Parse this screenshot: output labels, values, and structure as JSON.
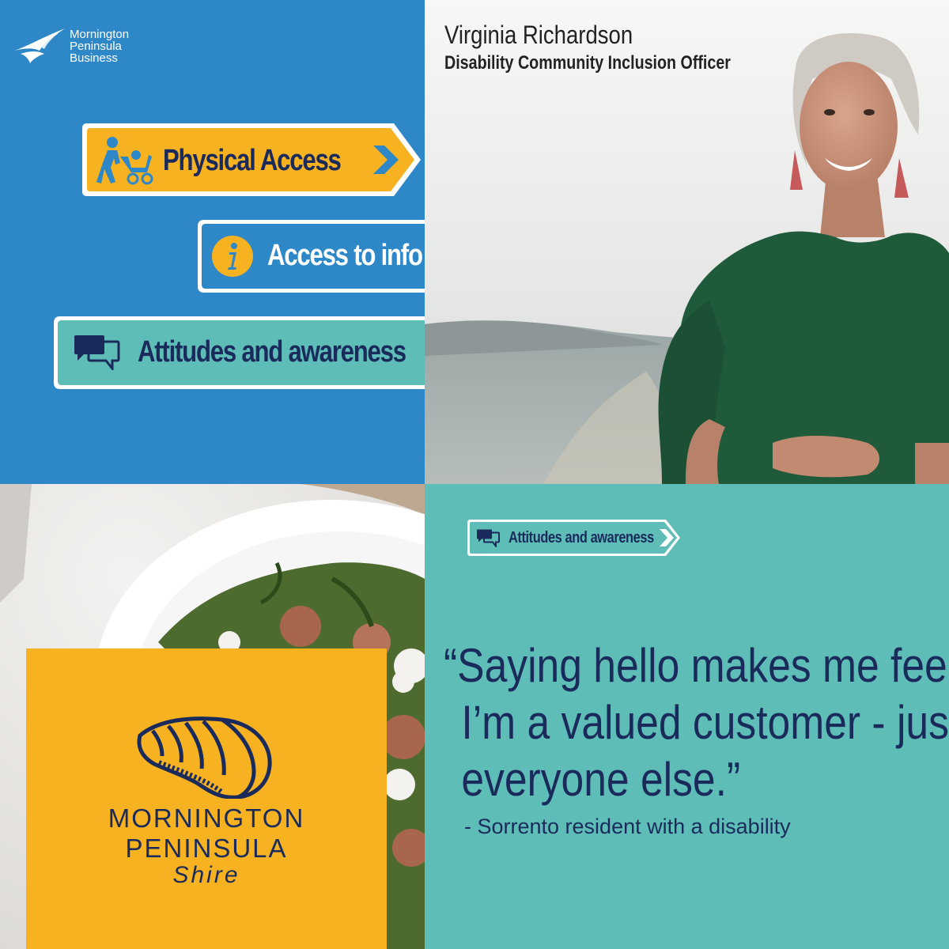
{
  "top_left": {
    "logo_lines": [
      "Mornington",
      "Peninsula",
      "Business"
    ],
    "buttons": [
      {
        "label": "Physical Access",
        "icon": "person-with-stroller-icon"
      },
      {
        "label": "Access to info",
        "icon": "info-icon"
      },
      {
        "label": "Attitudes and awareness",
        "icon": "speech-bubbles-icon"
      }
    ],
    "colors": {
      "background": "#2e88c8",
      "yellow": "#f7b221",
      "teal": "#5fbdb8",
      "navy": "#1a2b5b"
    }
  },
  "top_right": {
    "name": "Virginia Richardson",
    "title": "Disability Community Inclusion Officer"
  },
  "bottom_left": {
    "shire_logo": {
      "line1": "MORNINGTON",
      "line2": "PENINSULA",
      "line3": "Shire",
      "icon": "shell-icon"
    }
  },
  "bottom_right": {
    "tag_label": "Attitudes and awareness",
    "quote_lines": [
      "“Saying hello makes me feel",
      "I’m a valued customer - just",
      "everyone else.”"
    ],
    "attribution": "- Sorrento resident with a disability"
  }
}
